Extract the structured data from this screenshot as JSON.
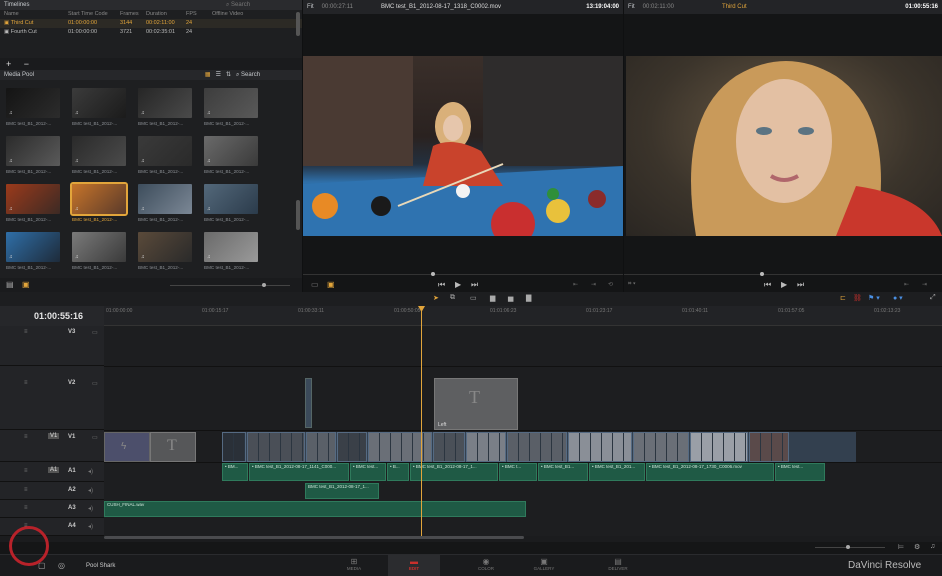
{
  "timelines_panel": {
    "title": "Timelines",
    "search_placeholder": "Search",
    "columns": [
      "Name",
      "Start Time Code",
      "Frames",
      "Duration",
      "FPS",
      "Offline Video"
    ],
    "rows": [
      {
        "name": "Third Cut",
        "start": "01:00:00:00",
        "frames": "3144",
        "duration": "00:02:11:00",
        "fps": "24",
        "offline": ""
      },
      {
        "name": "Fourth Cut",
        "start": "01:00:00:00",
        "frames": "3721",
        "duration": "00:02:35:01",
        "fps": "24",
        "offline": ""
      }
    ],
    "add_label": "+",
    "remove_label": "−"
  },
  "media_pool": {
    "title": "Media Pool",
    "search_placeholder": "Search",
    "clips": [
      "BMC test_B1_2012-...",
      "BMC test_B1_2012-...",
      "BMC test_B1_2012-...",
      "BMC test_B1_2012-...",
      "BMC test_B1_2012-...",
      "BMC test_B1_2012-...",
      "BMC test_B1_2012-...",
      "BMC test_B1_2012-...",
      "BMC test_B1_2012-...",
      "BMC test_B1_2012-...",
      "BMC test_B1_2012-...",
      "BMC test_B1_2012-...",
      "BMC test_B1_2012-...",
      "BMC test_B1_2012-...",
      "BMC test_B1_2012-...",
      "BMC test_B1_2012-..."
    ]
  },
  "source_viewer": {
    "fit": "Fit",
    "timecode": "00:00:27:11",
    "clip_name": "BMC test_B1_2012-08-17_1318_C0002.mov",
    "right_timecode": "13:19:04:00"
  },
  "timeline_viewer": {
    "fit": "Fit",
    "timecode": "00:02:11:00",
    "timeline_name": "Third Cut",
    "right_timecode": "01:00:55:16"
  },
  "timeline": {
    "current_timecode": "01:00:55:16",
    "ruler": [
      "01:00:00:00",
      "01:00:15:17",
      "01:00:33:11",
      "01:00:50:05",
      "01:01:06:23",
      "01:01:23:17",
      "01:01:40:11",
      "01:01:57:05",
      "01:02:13:23"
    ],
    "tracks": {
      "v3": "V3",
      "v2": "V2",
      "v1": "V1",
      "a1": "A1",
      "a2": "A2",
      "a3": "A3",
      "a4": "A4"
    },
    "title_clip_label": "Left",
    "audio_clips": [
      "• BM...",
      "• BMC test_B1_2012-08-17_1141_C000...",
      "• BMC test...",
      "• B...",
      "• BMC test_B1_2012-08-17_1...",
      "• BMC t...",
      "• BMC test_B1...",
      "• BMC test_B1_201...",
      "• BMC test_B1_2012-08-17_1730_C0006.mov",
      "• BMC test..."
    ],
    "a2_clip": "BMC test_B1_2012-08-17_1...",
    "a3_clip": "CUSH_FINAL.wav"
  },
  "bottom_bar": {
    "project_name": "Pool Shark",
    "pages": [
      "MEDIA",
      "EDIT",
      "COLOR",
      "GALLERY",
      "DELIVER"
    ],
    "active_page": "EDIT",
    "brand": "DaVinci Resolve"
  },
  "colors": {
    "accent": "#e2a53b",
    "active_red": "#c9302c",
    "audio_green": "#1f5a45"
  }
}
